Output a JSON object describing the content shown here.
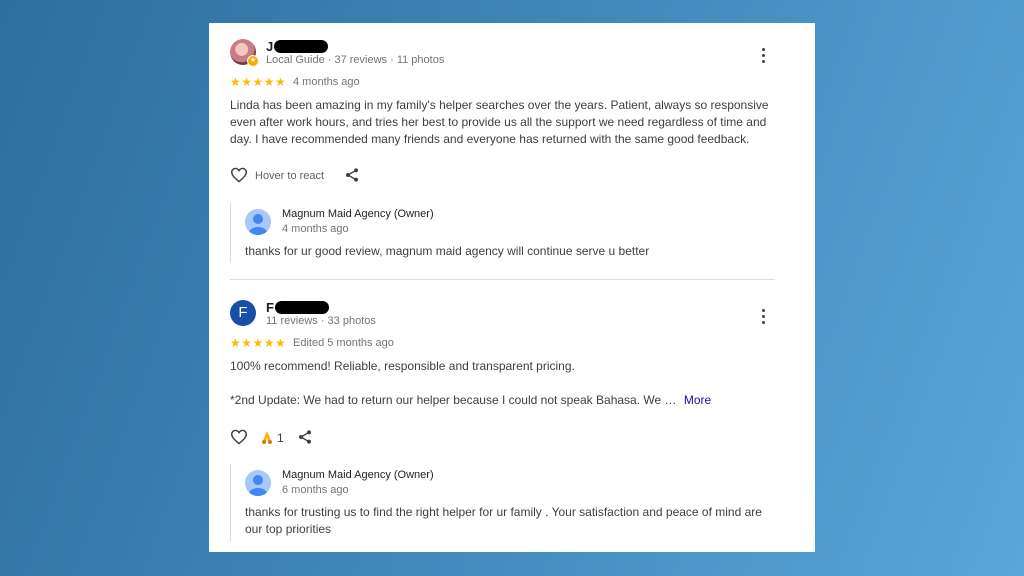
{
  "reviews": [
    {
      "name_initial": "J",
      "meta": "Local Guide · 37 reviews · 11 photos",
      "stars": "★★★★★",
      "rating": 5,
      "when": "4 months ago",
      "text": "Linda has been amazing in my family's helper searches over the years. Patient, always so responsive even after work hours, and tries her best to provide us all the support we need regardless of time and day. I have recommended many friends and everyone has returned with the same good feedback.",
      "react_label": "Hover to react",
      "reply": {
        "name": "Magnum Maid Agency (Owner)",
        "when": "4 months ago",
        "text": "thanks for ur good review, magnum maid agency will continue serve u better"
      }
    },
    {
      "name_initial": "F",
      "avatar_letter": "F",
      "meta": "11 reviews · 33 photos",
      "stars": "★★★★★",
      "rating": 5,
      "when": "Edited 5 months ago",
      "text1": "100% recommend! Reliable, responsible and transparent pricing.",
      "text2": "*2nd Update: We had to return our helper because I could not speak Bahasa. We …",
      "more_label": "More",
      "reaction_count": "1",
      "reply": {
        "name": "Magnum Maid Agency (Owner)",
        "when": "6 months ago",
        "text": "thanks for trusting us to find the right helper for ur family . Your satisfaction and peace of mind are our top priorities"
      }
    }
  ],
  "colors": {
    "star": "#fbbc04",
    "link": "#1a0dab",
    "avatar_f": "#174ea6"
  }
}
